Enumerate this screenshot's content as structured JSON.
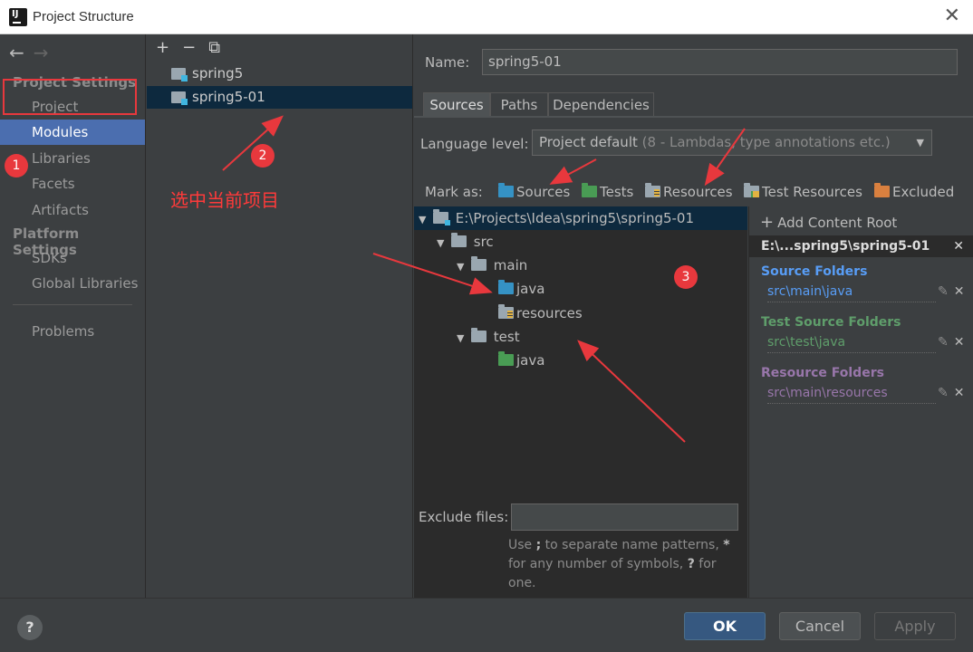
{
  "window": {
    "title": "Project Structure",
    "logo_text": "IJ"
  },
  "nav": {
    "back": "←",
    "forward": "→",
    "project_settings": "Project Settings",
    "items_top": [
      "Project",
      "Modules",
      "Libraries",
      "Facets",
      "Artifacts"
    ],
    "platform_settings": "Platform Settings",
    "items_platform": [
      "SDKs",
      "Global Libraries"
    ],
    "problems": "Problems",
    "selected": "Modules"
  },
  "modules": {
    "toolbar": {
      "add": "+",
      "remove": "−",
      "copy": "⧉"
    },
    "items": [
      "spring5",
      "spring5-01"
    ],
    "selected": "spring5-01"
  },
  "detail": {
    "name_label": "Name:",
    "name_value": "spring5-01",
    "tabs": [
      "Sources",
      "Paths",
      "Dependencies"
    ],
    "active_tab": "Sources",
    "language_label": "Language level:",
    "language_value": "Project default",
    "language_suffix": "(8 - Lambdas, type annotations etc.)",
    "mark_as_label": "Mark as:",
    "mark_as": [
      "Sources",
      "Tests",
      "Resources",
      "Test Resources",
      "Excluded"
    ],
    "tree": {
      "root": "E:\\Projects\\Idea\\spring5\\spring5-01",
      "src": "src",
      "main": "main",
      "main_java": "java",
      "main_resources": "resources",
      "test": "test",
      "test_java": "java"
    },
    "exclude_label": "Exclude files:",
    "exclude_value": "",
    "hint_1": "Use ",
    "hint_semicolon": ";",
    "hint_2": " to separate name patterns, ",
    "hint_star": "*",
    "hint_3": " for any number of symbols, ",
    "hint_q": "?",
    "hint_4": " for one."
  },
  "content_root": {
    "add_label": "Add Content Root",
    "header": "E:\\...spring5\\spring5-01",
    "source_title": "Source Folders",
    "source_path": "src\\main\\java",
    "test_title": "Test Source Folders",
    "test_path": "src\\test\\java",
    "resource_title": "Resource Folders",
    "resource_path": "src\\main\\resources",
    "colors": {
      "source": "#589df6",
      "test": "#5f9e6b",
      "resource": "#9876aa"
    }
  },
  "buttons": {
    "help": "?",
    "ok": "OK",
    "cancel": "Cancel",
    "apply": "Apply"
  },
  "annotations": {
    "b1": "1",
    "b2": "2",
    "b3": "3",
    "text": "选中当前项目",
    "color": "#e8383d"
  }
}
